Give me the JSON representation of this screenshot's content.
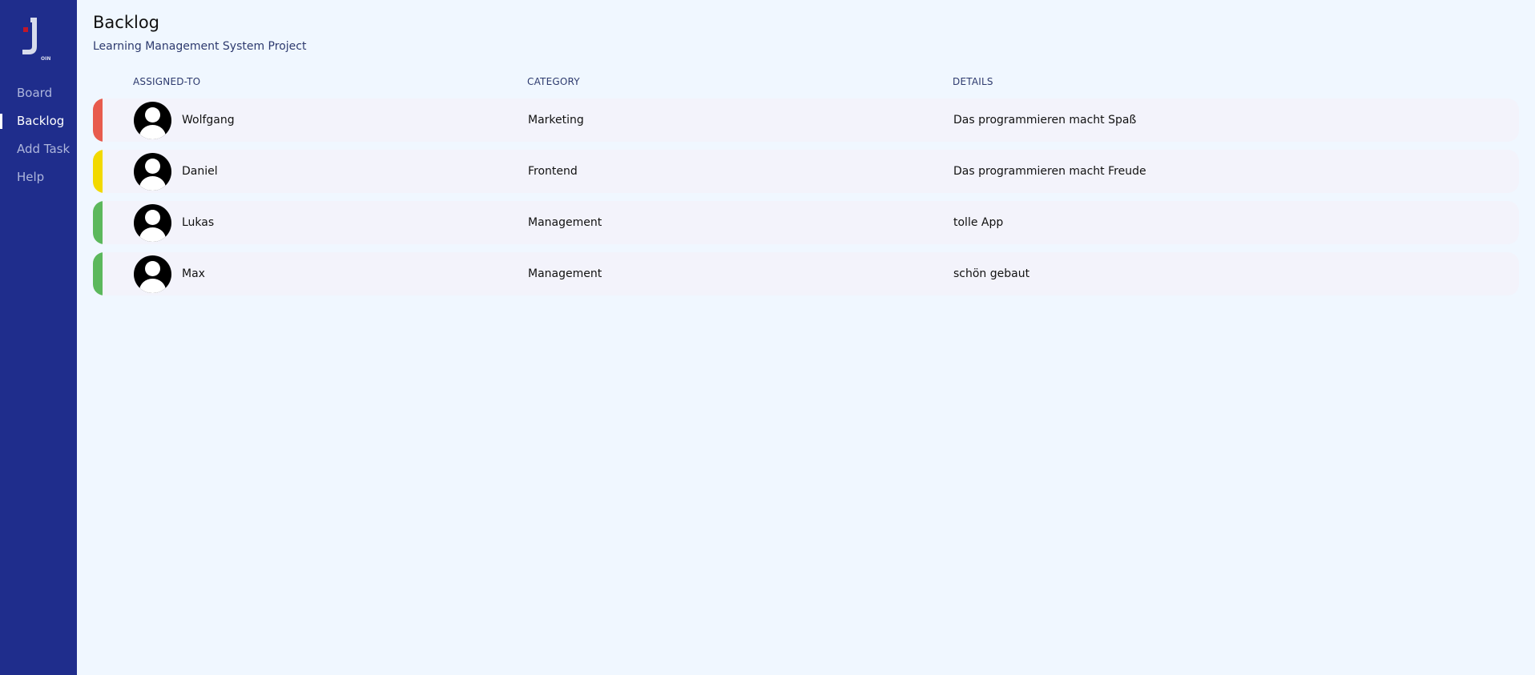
{
  "sidebar": {
    "logo_text": "JOIN",
    "items": [
      {
        "label": "Board"
      },
      {
        "label": "Backlog"
      },
      {
        "label": "Add Task"
      },
      {
        "label": "Help"
      }
    ],
    "active_item": "Backlog"
  },
  "page": {
    "title": "Backlog",
    "subtitle": "Learning Management System Project"
  },
  "table": {
    "headers": {
      "assigned_to": "ASSIGNED-TO",
      "category": "CATEGORY",
      "details": "DETAILS"
    },
    "rows": [
      {
        "name": "Wolfgang",
        "category": "Marketing",
        "details": "Das programmieren macht Spaß",
        "priority_color": "#e85b4d"
      },
      {
        "name": "Daniel",
        "category": "Frontend",
        "details": "Das programmieren macht Freude",
        "priority_color": "#f2d900"
      },
      {
        "name": "Lukas",
        "category": "Management",
        "details": "tolle App",
        "priority_color": "#5cb85c"
      },
      {
        "name": "Max",
        "category": "Management",
        "details": "schön gebaut",
        "priority_color": "#5cb85c"
      }
    ]
  },
  "colors": {
    "sidebar_bg": "#1f2d8c",
    "page_bg": "#f0f7ff",
    "row_bg": "#f3f3fb",
    "logo_accent": "#c0182a"
  }
}
